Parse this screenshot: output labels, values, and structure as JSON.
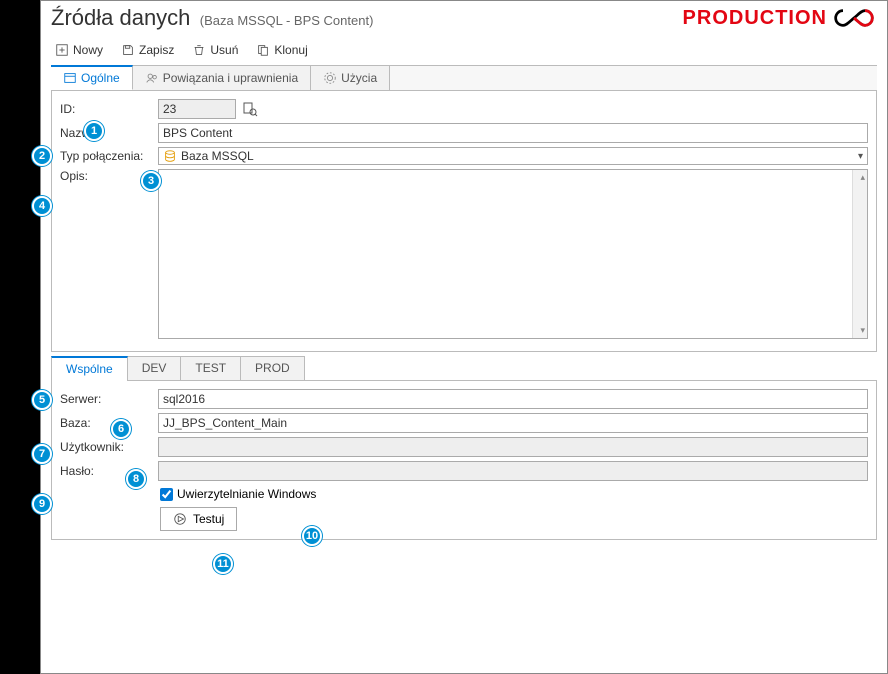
{
  "header": {
    "title": "Źródła danych",
    "subtitle": "(Baza MSSQL - BPS Content)",
    "env": "PRODUCTION"
  },
  "toolbar": {
    "nowy": "Nowy",
    "zapisz": "Zapisz",
    "usun": "Usuń",
    "klonuj": "Klonuj"
  },
  "tabs_main": {
    "ogolne": "Ogólne",
    "powiazania": "Powiązania i uprawnienia",
    "uzycia": "Użycia"
  },
  "form": {
    "id_label": "ID:",
    "id_value": "23",
    "nazwa_label": "Nazwa:",
    "nazwa_value": "BPS Content",
    "typ_label": "Typ połączenia:",
    "typ_value": "Baza MSSQL",
    "opis_label": "Opis:"
  },
  "subtabs": {
    "wspolne": "Wspólne",
    "dev": "DEV",
    "test": "TEST",
    "prod": "PROD"
  },
  "subform": {
    "serwer_label": "Serwer:",
    "serwer_value": "sql2016",
    "baza_label": "Baza:",
    "baza_value": "JJ_BPS_Content_Main",
    "uzytkownik_label": "Użytkownik:",
    "uzytkownik_value": "",
    "haslo_label": "Hasło:",
    "haslo_value": "",
    "winauth_label": "Uwierzytelnianie Windows",
    "winauth_checked": true,
    "testuj": "Testuj"
  },
  "callouts": {
    "c1": "1",
    "c2": "2",
    "c3": "3",
    "c4": "4",
    "c5": "5",
    "c6": "6",
    "c7": "7",
    "c8": "8",
    "c9": "9",
    "c10": "10",
    "c11": "11"
  }
}
